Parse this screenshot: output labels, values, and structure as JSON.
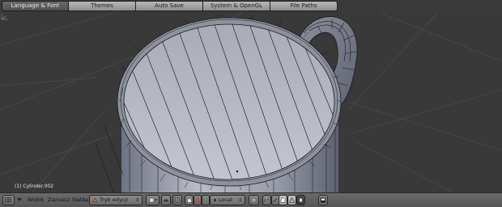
{
  "prefs_tabs": [
    {
      "label": "Language & Font",
      "active": true
    },
    {
      "label": "Themes",
      "active": false
    },
    {
      "label": "Auto Save",
      "active": false
    },
    {
      "label": "System & OpenGL",
      "active": false
    },
    {
      "label": "File Paths",
      "active": false
    }
  ],
  "viewport": {
    "object_label": "(1) Cylinder.002"
  },
  "header": {
    "menus": {
      "view": "Widok",
      "select": "Zaznacz",
      "mesh": "Siatka"
    },
    "mode": "Tryb edycji",
    "orientation": "Local"
  },
  "colors": {
    "mesh_face": "#b8bbc4",
    "mesh_shadow": "#7d8190",
    "wire": "#1a1a1a",
    "viewport_bg": "#393939",
    "grid": "#4a4a4a",
    "header_bg": "#606060"
  }
}
